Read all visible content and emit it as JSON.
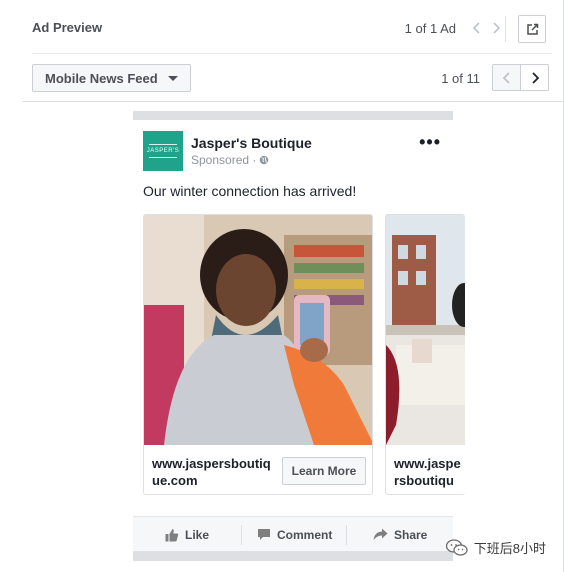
{
  "header": {
    "title": "Ad Preview",
    "counter": "1 of 1 Ad"
  },
  "toolbar": {
    "placement": "Mobile News Feed",
    "page_count": "1 of 11"
  },
  "ad": {
    "page_name": "Jasper's Boutique",
    "logo_text": "JASPER'S",
    "sponsored": "Sponsored ·",
    "caption": "Our winter connection has arrived!",
    "cards": [
      {
        "url": "www.jaspersboutique.com",
        "cta": "Learn More"
      },
      {
        "url": "www.jaspersboutique.com"
      }
    ],
    "actions": {
      "like": "Like",
      "comment": "Comment",
      "share": "Share"
    }
  },
  "watermark": {
    "text": "下班后8小时"
  },
  "colors": {
    "brand": "#1fa38a",
    "text": "#1d2129",
    "muted": "#90949c",
    "border": "#dddfe2"
  }
}
